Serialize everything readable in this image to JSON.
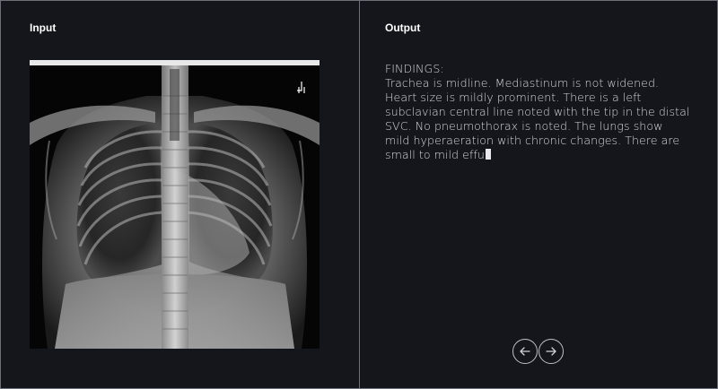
{
  "input_panel": {
    "title": "Input",
    "image_icon": "chest-xray-image"
  },
  "output_panel": {
    "title": "Output",
    "report_lines": [
      "FINDINGS:",
      "Trachea is midline. Mediastinum is not widened.",
      "Heart size is mildly prominent. There is a left",
      "subclavian central line noted with the tip in the distal",
      "SVC. No pneumothorax is noted. The lungs show",
      "mild hyperaeration with chronic changes. There are",
      "small to mild effu"
    ]
  },
  "navigation": {
    "prev_icon": "arrow-left-icon",
    "next_icon": "arrow-right-icon"
  },
  "colors": {
    "background": "#14161c",
    "border": "#6e7079",
    "text": "#d8d9de",
    "title": "#ffffff"
  }
}
